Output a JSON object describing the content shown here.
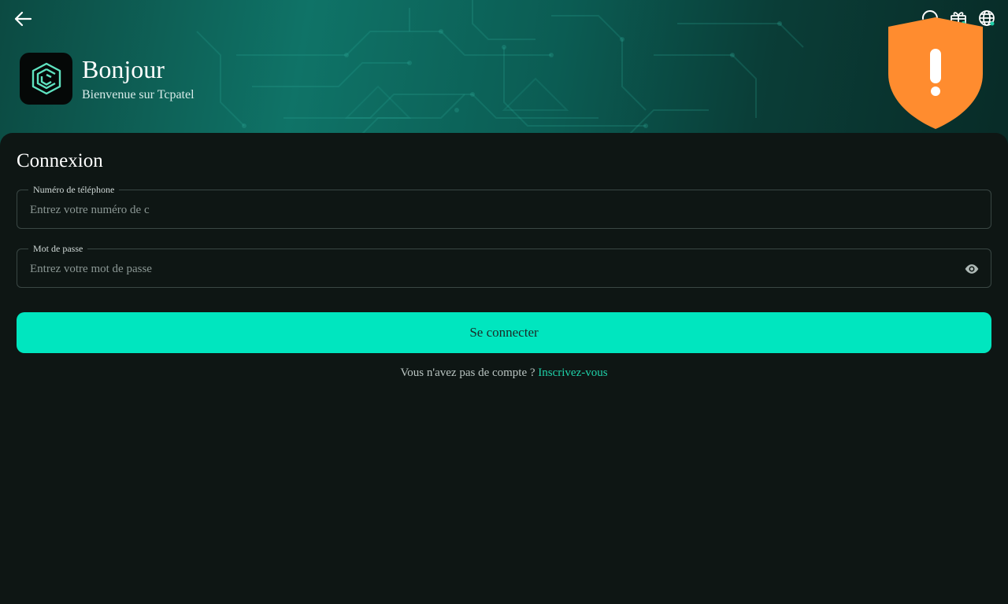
{
  "header": {
    "greeting": "Bonjour",
    "welcome": "Bienvenue sur Tcpatel",
    "back_icon": "arrow-left-icon",
    "top_icons": [
      "refresh-icon",
      "gift-box-icon",
      "globe-icon"
    ],
    "warning_icon": "shield-exclamation-icon"
  },
  "login": {
    "title": "Connexion",
    "phone": {
      "label": "Numéro de téléphone",
      "placeholder": "Entrez votre numéro de compte",
      "value": ""
    },
    "password": {
      "label": "Mot de passe",
      "placeholder": "Entrez votre mot de passe",
      "value": ""
    },
    "submit_label": "Se connecter",
    "signup_prompt": "Vous n'avez pas de compte ?",
    "signup_link": "Inscrivez-vous"
  },
  "colors": {
    "accent": "#00e6bf",
    "link": "#1fd1a9",
    "warning": "#ff8c2f",
    "background": "#0e1614"
  }
}
